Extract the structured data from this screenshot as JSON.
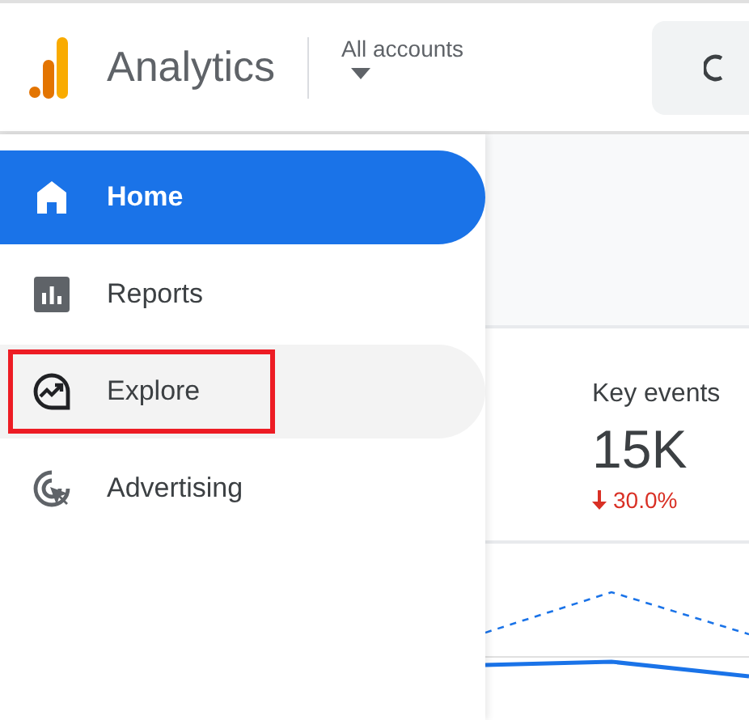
{
  "header": {
    "product_name": "Analytics",
    "account_picker": {
      "label": "All accounts"
    }
  },
  "sidebar": {
    "items": [
      {
        "label": "Home",
        "selected": true,
        "hovered": false,
        "highlighted": false
      },
      {
        "label": "Reports",
        "selected": false,
        "hovered": false,
        "highlighted": false
      },
      {
        "label": "Explore",
        "selected": false,
        "hovered": true,
        "highlighted": true
      },
      {
        "label": "Advertising",
        "selected": false,
        "hovered": false,
        "highlighted": false
      }
    ]
  },
  "metric_card": {
    "title": "Key events",
    "value": "15K",
    "change": {
      "negative": true,
      "text": "30.0%"
    }
  }
}
